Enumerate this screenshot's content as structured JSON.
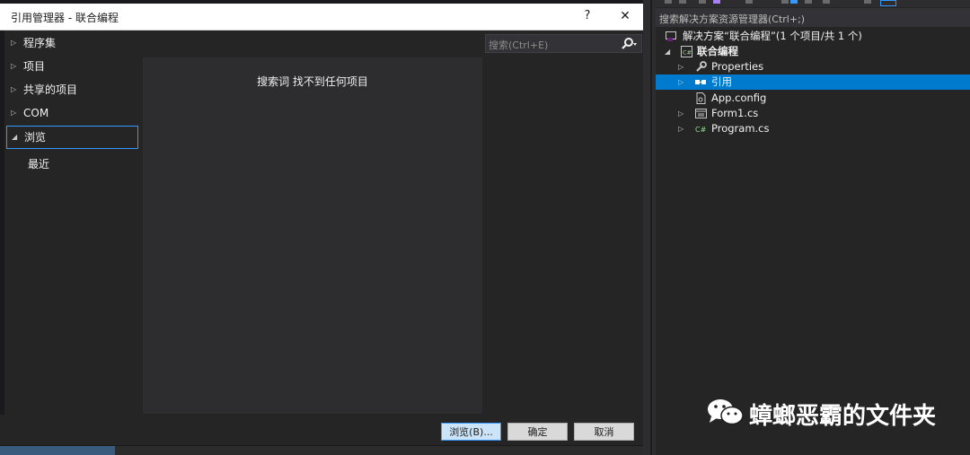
{
  "dialog": {
    "title": "引用管理器 - 联合编程",
    "help": "?",
    "close": "✕",
    "search_placeholder": "搜索(Ctrl+E)",
    "nav": [
      {
        "label": "程序集",
        "arrow": "▷"
      },
      {
        "label": "项目",
        "arrow": "▷"
      },
      {
        "label": "共享的项目",
        "arrow": "▷"
      },
      {
        "label": "COM",
        "arrow": "▷"
      },
      {
        "label": "浏览",
        "arrow": "◢"
      }
    ],
    "nav_sub": "最近",
    "empty_message": "搜索词  找不到任何项目",
    "buttons": {
      "browse": "浏览(B)...",
      "ok": "确定",
      "cancel": "取消"
    }
  },
  "solution_explorer": {
    "search_placeholder": "搜索解决方案资源管理器(Ctrl+;)",
    "tree": [
      {
        "label": "解决方案“联合编程”(1 个项目/共 1 个)",
        "icon": "solution-icon",
        "arrow": ""
      },
      {
        "label": "联合编程",
        "icon": "csharp-project-icon",
        "arrow": "◢"
      },
      {
        "label": "Properties",
        "icon": "wrench-icon",
        "arrow": "▷"
      },
      {
        "label": "引用",
        "icon": "references-icon",
        "arrow": "▷"
      },
      {
        "label": "App.config",
        "icon": "config-file-icon",
        "arrow": ""
      },
      {
        "label": "Form1.cs",
        "icon": "form-icon",
        "arrow": "▷"
      },
      {
        "label": "Program.cs",
        "icon": "csharp-file-icon",
        "arrow": "▷"
      }
    ],
    "selected_index": 3
  },
  "watermark": {
    "text": "蟑螂恶霸的文件夹",
    "icon": "wechat-icon"
  },
  "colors": {
    "accent": "#007acc",
    "selection_border": "#3399ff",
    "background": "#252526"
  }
}
